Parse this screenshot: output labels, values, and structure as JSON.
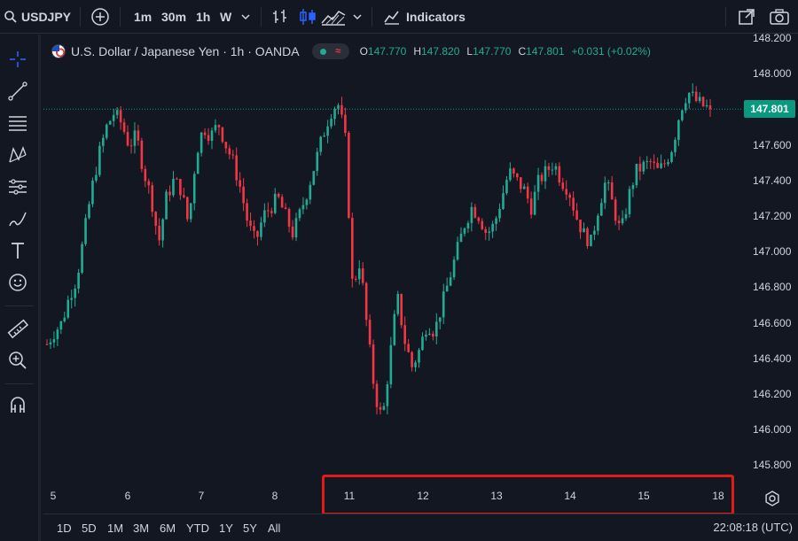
{
  "toolbar": {
    "symbol": "USDJPY",
    "timeframes": [
      "1m",
      "30m",
      "1h",
      "W"
    ],
    "active_timeframe": "1h",
    "indicators_label": "Indicators"
  },
  "legend": {
    "title": "U.S. Dollar / Japanese Yen · 1h · OANDA",
    "ohlc": [
      {
        "k": "O",
        "v": "147.770"
      },
      {
        "k": "H",
        "v": "147.820"
      },
      {
        "k": "L",
        "v": "147.770"
      },
      {
        "k": "C",
        "v": "147.801"
      }
    ],
    "change": "+0.031 (+0.02%)"
  },
  "price_scale": {
    "labels": [
      "148.200",
      "148.000",
      "147.800",
      "147.600",
      "147.400",
      "147.200",
      "147.000",
      "146.800",
      "146.600",
      "146.400",
      "146.200",
      "146.000",
      "145.800"
    ],
    "last_price": "147.801"
  },
  "time_scale": {
    "labels": [
      "5",
      "6",
      "7",
      "8",
      "11",
      "12",
      "13",
      "14",
      "15",
      "18"
    ]
  },
  "ranges": [
    "1D",
    "5D",
    "1M",
    "3M",
    "6M",
    "YTD",
    "1Y",
    "5Y",
    "All"
  ],
  "clock": "22:08:18 (UTC)",
  "colors": {
    "up": "#22ab94",
    "down": "#f23645",
    "background": "#131722",
    "accent": "#2962ff",
    "highlight_box": "#e01919"
  },
  "chart_data": {
    "type": "candlestick",
    "title": "U.S. Dollar / Japanese Yen · 1h · OANDA",
    "ylim": [
      145.7,
      148.2
    ],
    "x_ticks": [
      "5",
      "6",
      "7",
      "8",
      "11",
      "12",
      "13",
      "14",
      "15",
      "18"
    ],
    "last_price": 147.801,
    "close_path": [
      146.48,
      146.55,
      146.6,
      146.75,
      146.85,
      147.1,
      147.35,
      147.55,
      147.7,
      147.78,
      147.72,
      147.6,
      147.65,
      147.45,
      147.3,
      147.05,
      147.3,
      147.4,
      147.35,
      147.15,
      147.55,
      147.7,
      147.65,
      147.72,
      147.6,
      147.5,
      147.35,
      147.15,
      147.05,
      147.2,
      147.25,
      147.3,
      147.2,
      147.1,
      147.22,
      147.35,
      147.5,
      147.65,
      147.78,
      147.84,
      147.65,
      146.8,
      146.95,
      146.55,
      146.2,
      146.05,
      146.4,
      146.75,
      146.5,
      146.35,
      146.45,
      146.6,
      146.55,
      146.7,
      146.85,
      147.0,
      147.15,
      147.25,
      147.2,
      147.1,
      147.15,
      147.3,
      147.45,
      147.4,
      147.35,
      147.25,
      147.4,
      147.45,
      147.5,
      147.4,
      147.35,
      147.2,
      147.1,
      147.05,
      147.25,
      147.4,
      147.25,
      147.1,
      147.3,
      147.45,
      147.48,
      147.5,
      147.45,
      147.5,
      147.6,
      147.8,
      147.9,
      147.85,
      147.82,
      147.8
    ]
  }
}
